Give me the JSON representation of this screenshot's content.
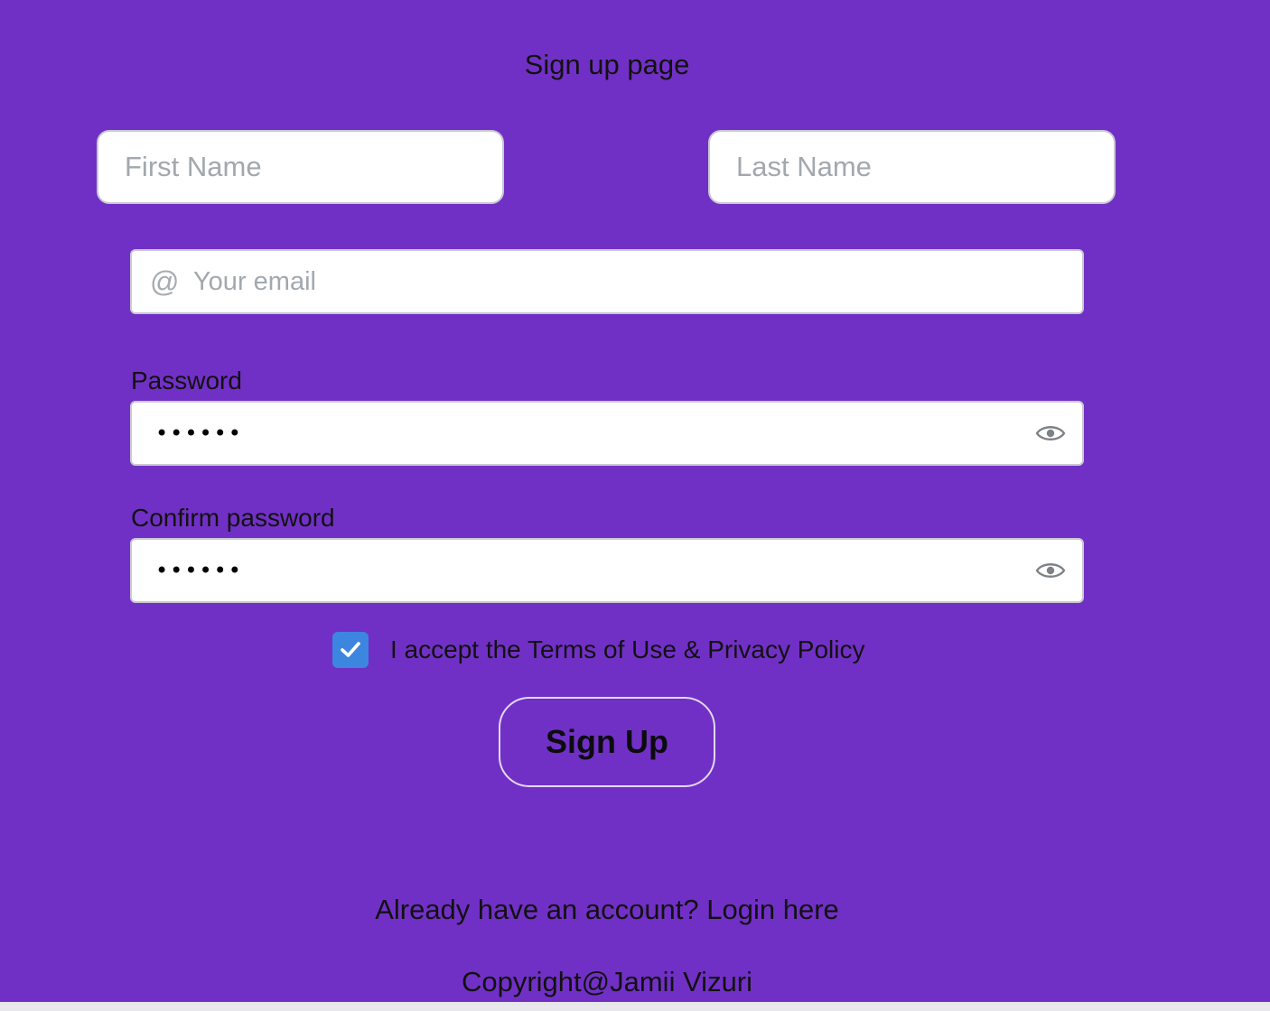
{
  "page": {
    "title": "Sign up page"
  },
  "form": {
    "first_name_placeholder": "First Name",
    "last_name_placeholder": "Last Name",
    "email_placeholder": "Your email",
    "email_icon": "at-sign-icon",
    "password_label": "Password",
    "password_value": "••••••",
    "confirm_label": "Confirm password",
    "confirm_value": "••••••",
    "visibility_icon": "eye-icon",
    "terms_checked": true,
    "terms_text": "I accept the Terms of Use & Privacy Policy",
    "submit_label": "Sign Up"
  },
  "footer": {
    "login_prompt": "Already have an account?",
    "login_link": "Login here",
    "copyright": "Copyright@Jamii Vizuri"
  },
  "colors": {
    "background": "#7130c5",
    "checkbox": "#3d86e0",
    "placeholder": "#a2a8ae"
  }
}
